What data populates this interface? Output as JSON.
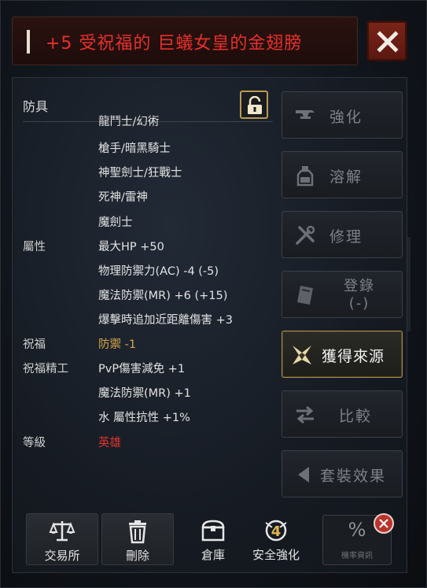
{
  "title": {
    "item_name": "+5 受祝福的 巨蟻女皇的金翅膀"
  },
  "info": {
    "category": "防具",
    "lines": [
      {
        "label": "",
        "value": "龍鬥士/幻術",
        "tone": "normal"
      },
      {
        "label": "",
        "value": "槍手/暗黑騎士",
        "tone": "normal"
      },
      {
        "label": "",
        "value": "神聖劍士/狂戰士",
        "tone": "normal"
      },
      {
        "label": "",
        "value": "死神/雷神",
        "tone": "normal"
      },
      {
        "label": "",
        "value": "魔劍士",
        "tone": "normal"
      },
      {
        "label": "屬性",
        "value": "最大HP +50",
        "tone": "normal"
      },
      {
        "label": "",
        "value": "物理防禦力(AC) -4 (-5)",
        "tone": "normal"
      },
      {
        "label": "",
        "value": "魔法防禦(MR) +6 (+15)",
        "tone": "normal"
      },
      {
        "label": "",
        "value": "爆擊時追加近距離傷害 +3",
        "tone": "normal"
      },
      {
        "label": "祝福",
        "value": "防禦 -1",
        "tone": "gold"
      },
      {
        "label": "祝福精工",
        "value": "PvP傷害減免 +1",
        "tone": "normal"
      },
      {
        "label": "",
        "value": "魔法防禦(MR) +1",
        "tone": "normal"
      },
      {
        "label": "",
        "value": "水 屬性抗性 +1%",
        "tone": "normal"
      },
      {
        "label": "等級",
        "value": "英雄",
        "tone": "red"
      }
    ]
  },
  "actions": {
    "enhance": "強化",
    "dissolve": "溶解",
    "repair": "修理",
    "register_line1": "登錄",
    "register_line2": "(-)",
    "obtain_source": "獲得來源",
    "compare": "比較",
    "set_effect": "套裝效果"
  },
  "bottom": {
    "exchange": "交易所",
    "delete": "刪除",
    "warehouse": "倉庫",
    "safe_enhance": "安全強化",
    "safe_enhance_badge": "4",
    "rate_symbol": "%",
    "rate_info": "機率資訊"
  },
  "colors": {
    "title_red": "#e8302a",
    "gold": "#d4a648",
    "hero_red": "#e2332a",
    "active_border": "#a98b4c"
  }
}
